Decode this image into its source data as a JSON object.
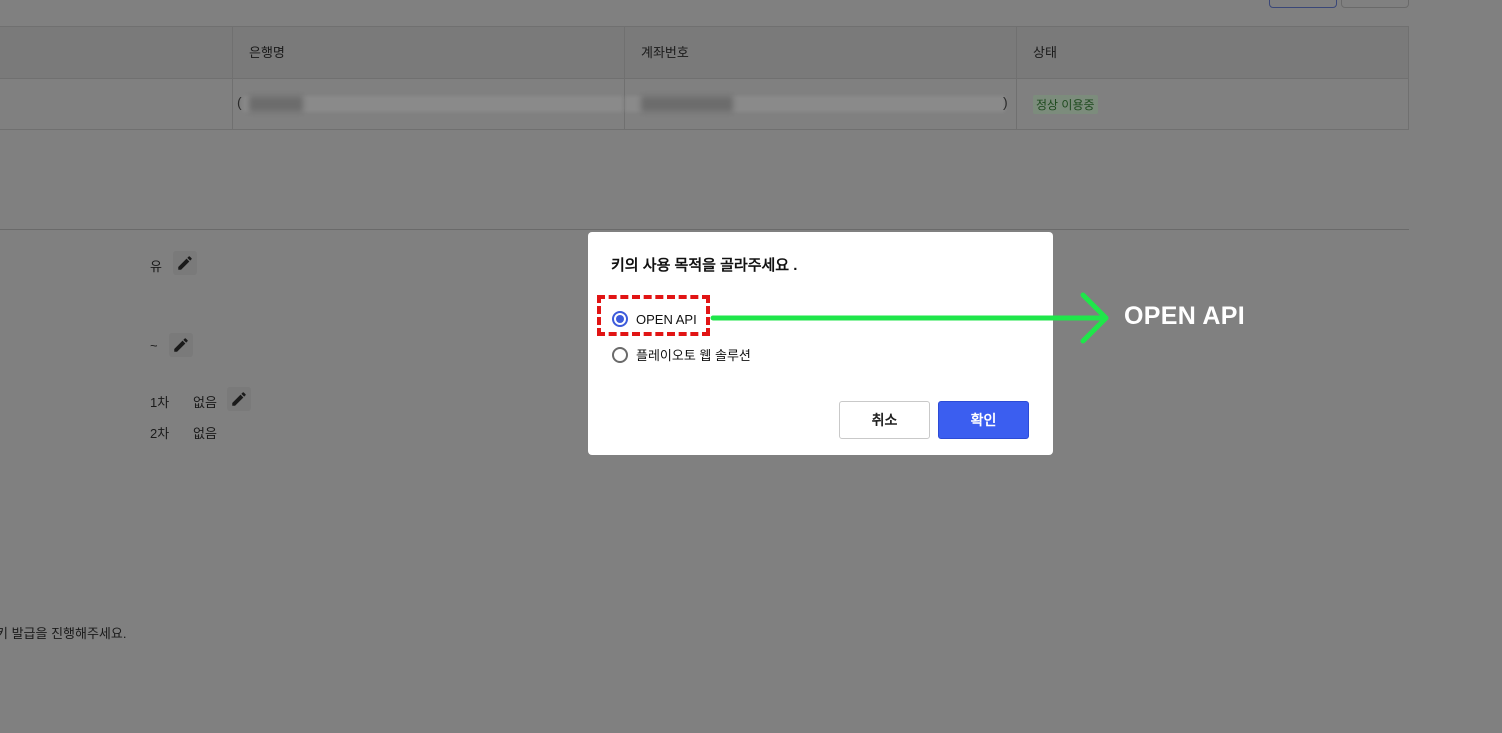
{
  "table": {
    "columns": [
      "은행명",
      "계좌번호",
      "상태"
    ],
    "row": {
      "bank_name": "",
      "account_number": "",
      "status": "정상 이용중",
      "paren_open": "(",
      "paren_close": ")"
    }
  },
  "form": {
    "row1_value": "유",
    "row2_value": "~",
    "row3_label": "1차",
    "row3_value": "없음",
    "row4_label": "2차",
    "row4_value": "없음"
  },
  "footer_note": "키 발급을 진행해주세요.",
  "modal": {
    "title": "키의 사용 목적을 골라주세요 .",
    "options": [
      {
        "label": "OPEN API",
        "checked": true
      },
      {
        "label": "플레이오토 웹 솔루션",
        "checked": false
      }
    ],
    "cancel_label": "취소",
    "confirm_label": "확인"
  },
  "annotation": {
    "label": "OPEN API",
    "arrow_color": "#1fe64a",
    "box_color": "#e11414"
  },
  "colors": {
    "accent": "#3b5ef0",
    "overlay": "#808080"
  },
  "icons": [
    "pencil-icon"
  ]
}
